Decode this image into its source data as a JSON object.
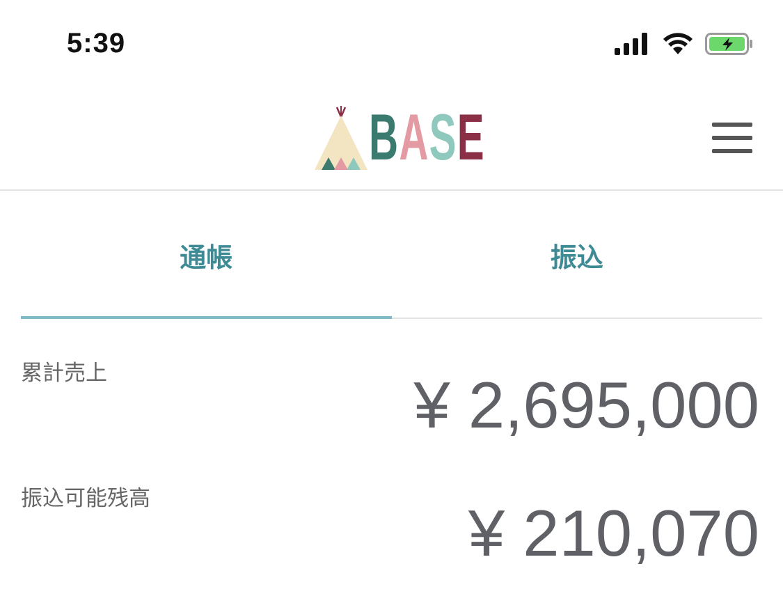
{
  "status_bar": {
    "time": "5:39",
    "icons": [
      "cellular-signal-icon",
      "wifi-icon",
      "battery-charging-icon"
    ],
    "battery_color": "#6cd86c"
  },
  "header": {
    "logo_text": "BASE",
    "logo_colors": [
      "#3b7a6e",
      "#e39aa3",
      "#8fc9bd",
      "#8b2f47"
    ],
    "menu_icon": "hamburger-menu-icon"
  },
  "tabs": [
    {
      "label": "通帳",
      "active": true
    },
    {
      "label": "振込",
      "active": false
    }
  ],
  "accent_color": "#3e8a95",
  "summary": {
    "total_sales_label": "累計売上",
    "total_sales_value": "¥ 2,695,000",
    "available_balance_label": "振込可能残高",
    "available_balance_value": "¥ 210,070"
  }
}
